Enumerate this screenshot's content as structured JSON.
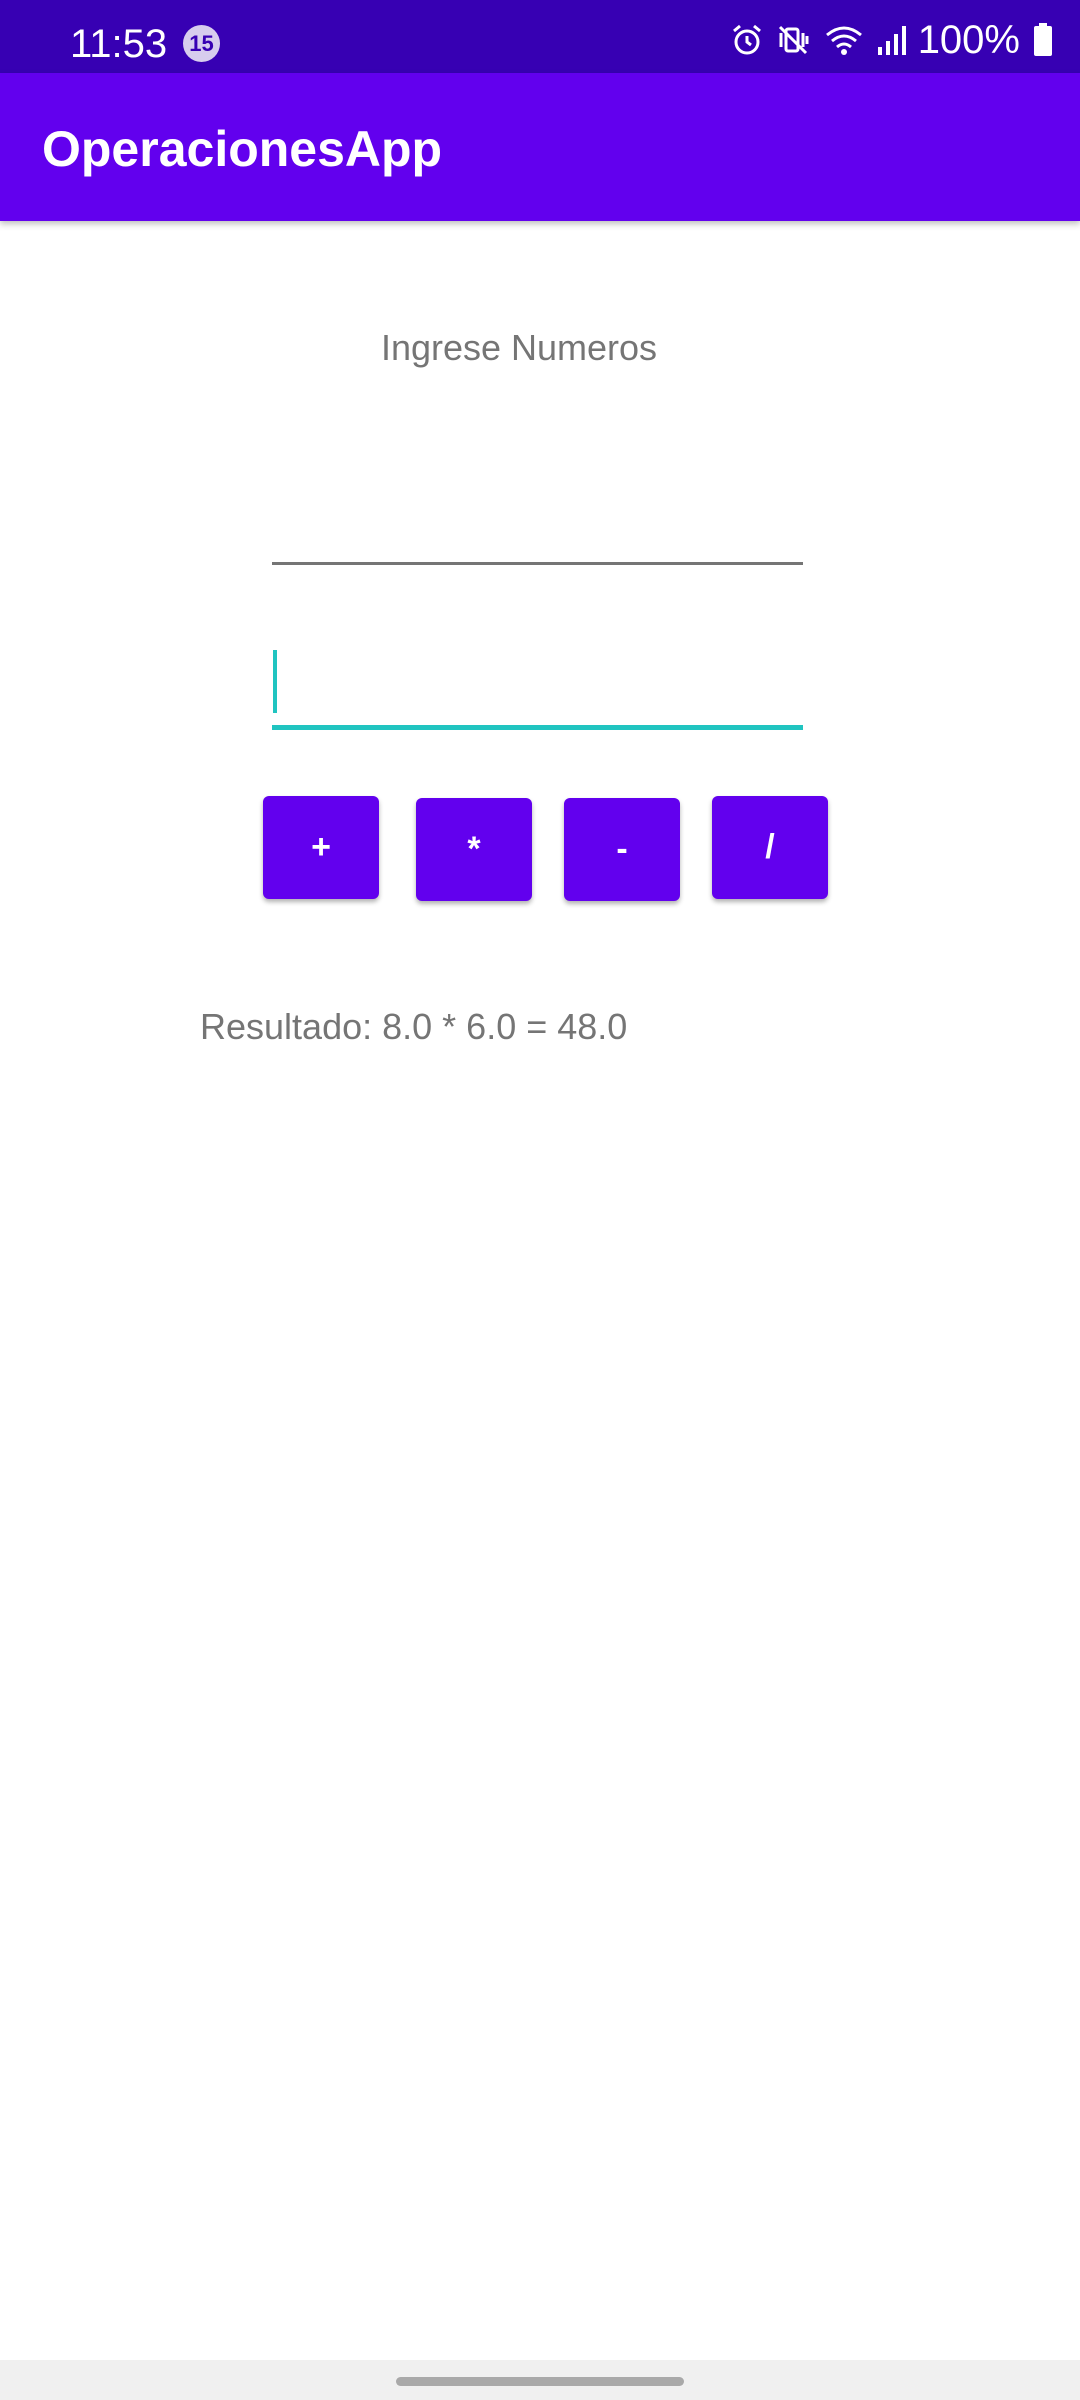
{
  "status_bar": {
    "time": "11:53",
    "notification_count": "15",
    "battery": "100%",
    "icons": [
      "alarm-icon",
      "mute-vibrate-icon",
      "wifi-icon",
      "signal-icon",
      "battery-icon"
    ]
  },
  "app_bar": {
    "title": "OperacionesApp"
  },
  "main": {
    "prompt": "Ingrese Numeros",
    "input_1_value": "",
    "input_2_value": "",
    "buttons": {
      "plus": "+",
      "multiply": "*",
      "minus": "-",
      "divide": "/"
    },
    "result": "Resultado: 8.0 * 6.0 = 48.0"
  },
  "colors": {
    "status_bar": "#3700b3",
    "primary": "#6200ee",
    "accent": "#20c4c0",
    "text_secondary": "#757575"
  }
}
